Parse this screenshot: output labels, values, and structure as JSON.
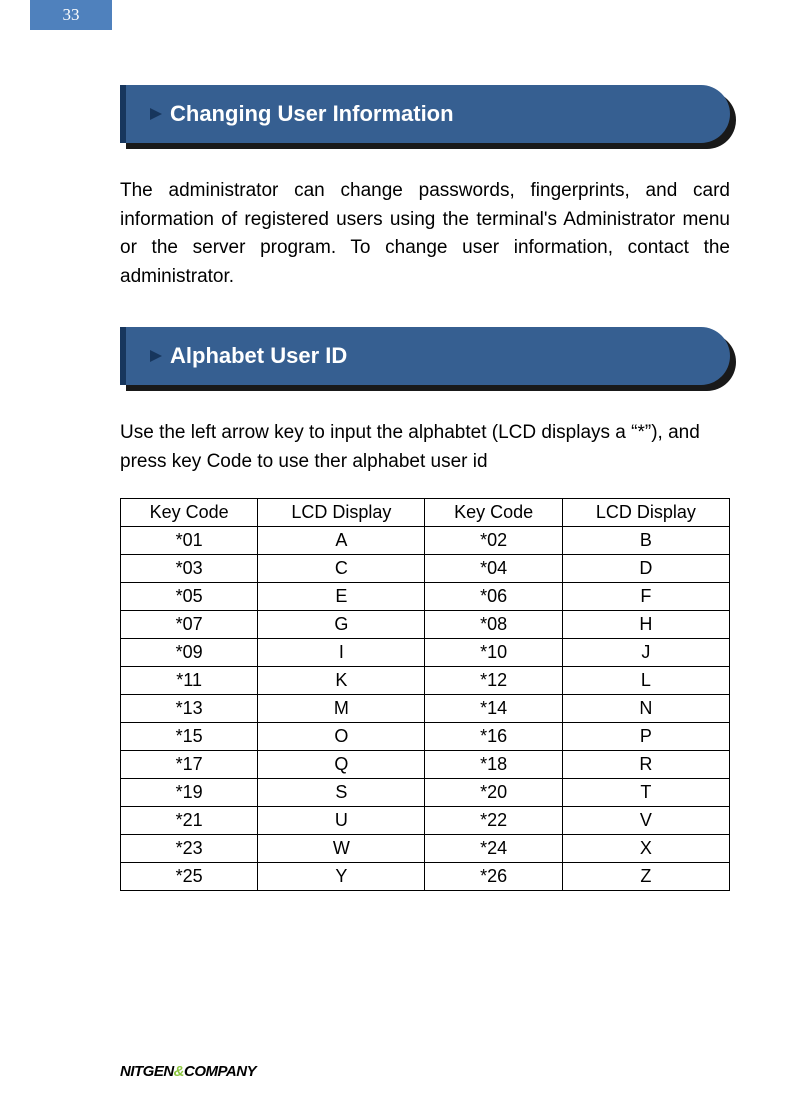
{
  "page_number": "33",
  "section1": {
    "title": "Changing User Information",
    "body": "The administrator can change passwords, fingerprints, and card information of registered users using the terminal's Administrator menu or the server program. To change user information, contact the administrator."
  },
  "section2": {
    "title": "Alphabet User ID",
    "body": "Use the left arrow key to input the alphabtet (LCD displays a “*”), and press key Code to use ther alphabet user id"
  },
  "table": {
    "headers": [
      "Key Code",
      "LCD Display",
      "Key Code",
      "LCD Display"
    ],
    "rows": [
      [
        "*01",
        "A",
        "*02",
        "B"
      ],
      [
        "*03",
        "C",
        "*04",
        "D"
      ],
      [
        "*05",
        "E",
        "*06",
        "F"
      ],
      [
        "*07",
        "G",
        "*08",
        "H"
      ],
      [
        "*09",
        "I",
        "*10",
        "J"
      ],
      [
        "*11",
        "K",
        "*12",
        "L"
      ],
      [
        "*13",
        "M",
        "*14",
        "N"
      ],
      [
        "*15",
        "O",
        "*16",
        "P"
      ],
      [
        "*17",
        "Q",
        "*18",
        "R"
      ],
      [
        "*19",
        "S",
        "*20",
        "T"
      ],
      [
        "*21",
        "U",
        "*22",
        "V"
      ],
      [
        "*23",
        "W",
        "*24",
        "X"
      ],
      [
        "*25",
        "Y",
        "*26",
        "Z"
      ]
    ]
  },
  "footer": {
    "part1": "NITGEN",
    "amp": "&",
    "part2": "COMPANY"
  }
}
